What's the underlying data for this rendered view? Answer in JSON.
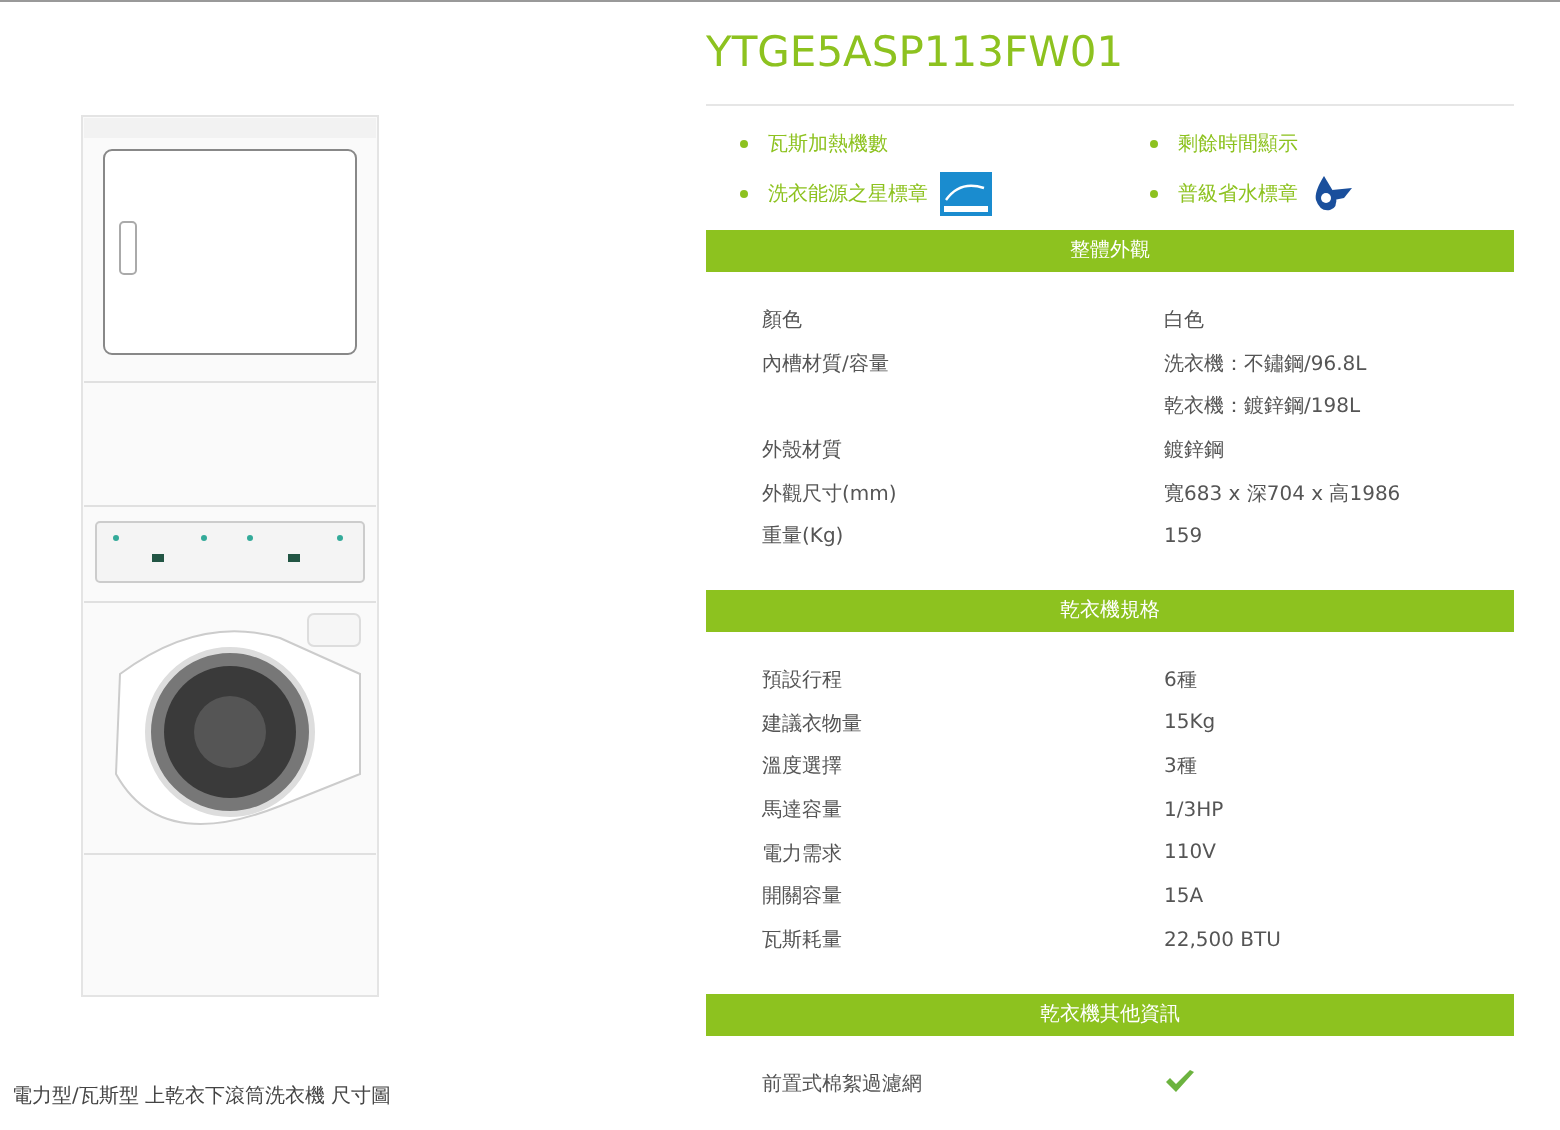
{
  "product": {
    "model": "YTGE5ASP113FW01",
    "caption": "電力型/瓦斯型 上乾衣下滾筒洗衣機 尺寸圖"
  },
  "features": [
    {
      "label": "瓦斯加熱機數",
      "kind": "plain"
    },
    {
      "label": "剩餘時間顯示",
      "kind": "plain"
    },
    {
      "label": "洗衣能源之星標章",
      "kind": "energy"
    },
    {
      "label": "普級省水標章",
      "kind": "water"
    }
  ],
  "sections": [
    {
      "title": "整體外觀",
      "rows": [
        {
          "label": "顏色",
          "kind": "text",
          "value": "白色"
        },
        {
          "label": "內槽材質/容量",
          "kind": "text",
          "value": "洗衣機：不鏽鋼/96.8L"
        },
        {
          "label": "",
          "kind": "text",
          "value": "乾衣機：鍍鋅鋼/198L"
        },
        {
          "label": "外殼材質",
          "kind": "text",
          "value": "鍍鋅鋼"
        },
        {
          "label": "外觀尺寸(mm)",
          "kind": "text",
          "value": "寬683 x 深704 x 高1986"
        },
        {
          "label": "重量(Kg)",
          "kind": "text",
          "value": "159"
        }
      ]
    },
    {
      "title": "乾衣機規格",
      "rows": [
        {
          "label": "預設行程",
          "kind": "text",
          "value": "6種"
        },
        {
          "label": "建議衣物量",
          "kind": "text",
          "value": "15Kg"
        },
        {
          "label": "溫度選擇",
          "kind": "text",
          "value": "3種"
        },
        {
          "label": "馬達容量",
          "kind": "text",
          "value": "1/3HP"
        },
        {
          "label": "電力需求",
          "kind": "text",
          "value": "110V"
        },
        {
          "label": "開關容量",
          "kind": "text",
          "value": "15A"
        },
        {
          "label": "瓦斯耗量",
          "kind": "text",
          "value": "22,500 BTU"
        }
      ]
    },
    {
      "title": "乾衣機其他資訊",
      "rows": [
        {
          "label": "前置式棉絮過濾網",
          "kind": "check",
          "checked": true
        }
      ]
    }
  ]
}
